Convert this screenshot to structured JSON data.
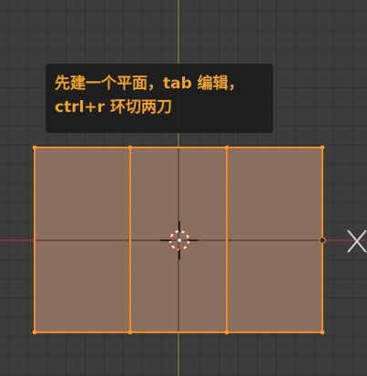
{
  "app": "3D viewport (mesh edit mode)",
  "tooltip": {
    "line1": "先建一个平面，tab 编辑，",
    "line2": "ctrl+r 环切两刀"
  },
  "mode": "edit-mode",
  "view": "top-orthographic",
  "mesh": {
    "object": "plane",
    "loop_cuts": 2,
    "selected": true
  },
  "colors": {
    "background": "#3c3c3c",
    "grid": "#333333",
    "x_axis": "#8e3d44",
    "y_axis": "#5f7d3a",
    "face_fill": "#8f7260",
    "edge_selected": "#f08a24",
    "vertex_selected": "#ff9f2a",
    "tooltip_bg": "#1c1c1c",
    "tooltip_text": "#f0a22a",
    "cursor_ring": "#e0443c"
  },
  "icons": [
    "3d-cursor-icon",
    "object-origin-icon"
  ]
}
